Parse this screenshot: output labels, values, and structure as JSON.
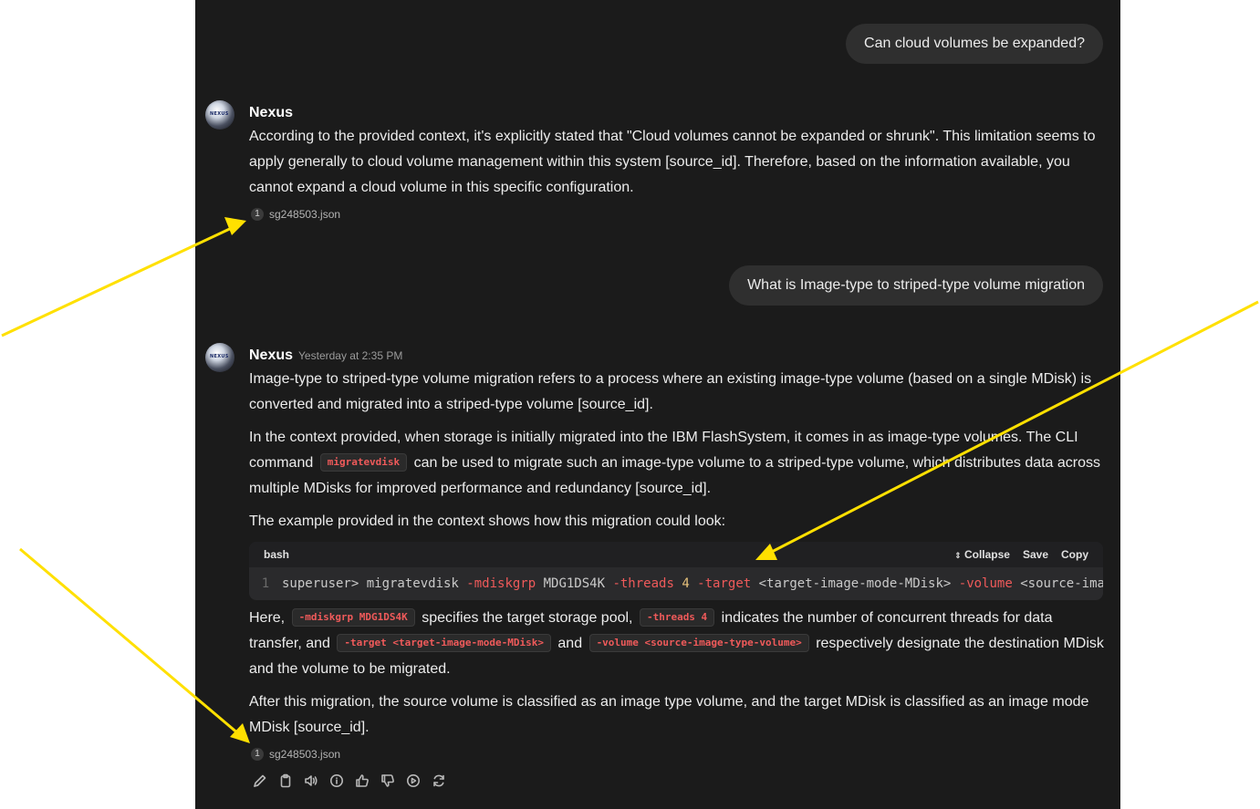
{
  "conversation": {
    "q1": "Can cloud volumes be expanded?",
    "a1": {
      "sender": "Nexus",
      "text": "According to the provided context, it's explicitly stated that \"Cloud volumes cannot be expanded or shrunk\". This limitation seems to apply generally to cloud volume management within this system [source_id]. Therefore, based on the information available, you cannot expand a cloud volume in this specific configuration.",
      "source_num": "1",
      "source_file": "sg248503.json"
    },
    "q2": "What is Image-type to striped-type volume migration",
    "a2": {
      "sender": "Nexus",
      "time": "Yesterday at 2:35 PM",
      "p1": "Image-type to striped-type volume migration refers to a process where an existing image-type volume (based on a single MDisk) is converted and migrated into a striped-type volume [source_id].",
      "p2_a": "In the context provided, when storage is initially migrated into the IBM FlashSystem, it comes in as image-type volumes. The CLI command",
      "p2_code": "migratevdisk",
      "p2_b": "can be used to migrate such an image-type volume to a striped-type volume, which distributes data across multiple MDisks for improved performance and redundancy [source_id].",
      "p3": "The example provided in the context shows how this migration could look:",
      "code": {
        "lang": "bash",
        "collapse": "Collapse",
        "save": "Save",
        "copy": "Copy",
        "line_no": "1",
        "t1": "superuser> migratevdisk ",
        "t2": "-mdiskgrp",
        "t3": " MDG1DS4K ",
        "t4": "-threads",
        "t5": " 4",
        "t6": " -target",
        "t7": " <target-image-mode-MDisk> ",
        "t8": "-volume",
        "t9": " <source-image-type-volume>"
      },
      "p4_a": "Here,",
      "p4_c1": "-mdiskgrp MDG1DS4K",
      "p4_b": "specifies the target storage pool,",
      "p4_c2": "-threads 4",
      "p4_c": "indicates the number of concurrent threads for data transfer, and",
      "p4_c3": "-target <target-image-mode-MDisk>",
      "p4_d": "and",
      "p4_c4": "-volume <source-image-type-volume>",
      "p4_e": "respectively designate the destination MDisk and the volume to be migrated.",
      "p5": "After this migration, the source volume is classified as an image type volume, and the target MDisk is classified as an image mode MDisk [source_id].",
      "source_num": "1",
      "source_file": "sg248503.json"
    },
    "avatar_text": "NEXUS"
  },
  "icons": [
    "edit-icon",
    "copy-icon",
    "speaker-icon",
    "info-icon",
    "thumbs-up-icon",
    "thumbs-down-icon",
    "play-icon",
    "regenerate-icon"
  ],
  "colors": {
    "panel": "#1b1b1b",
    "bubble": "#2f2f2f",
    "code_accent": "#ef5a5a",
    "arrow": "#ffe000"
  }
}
